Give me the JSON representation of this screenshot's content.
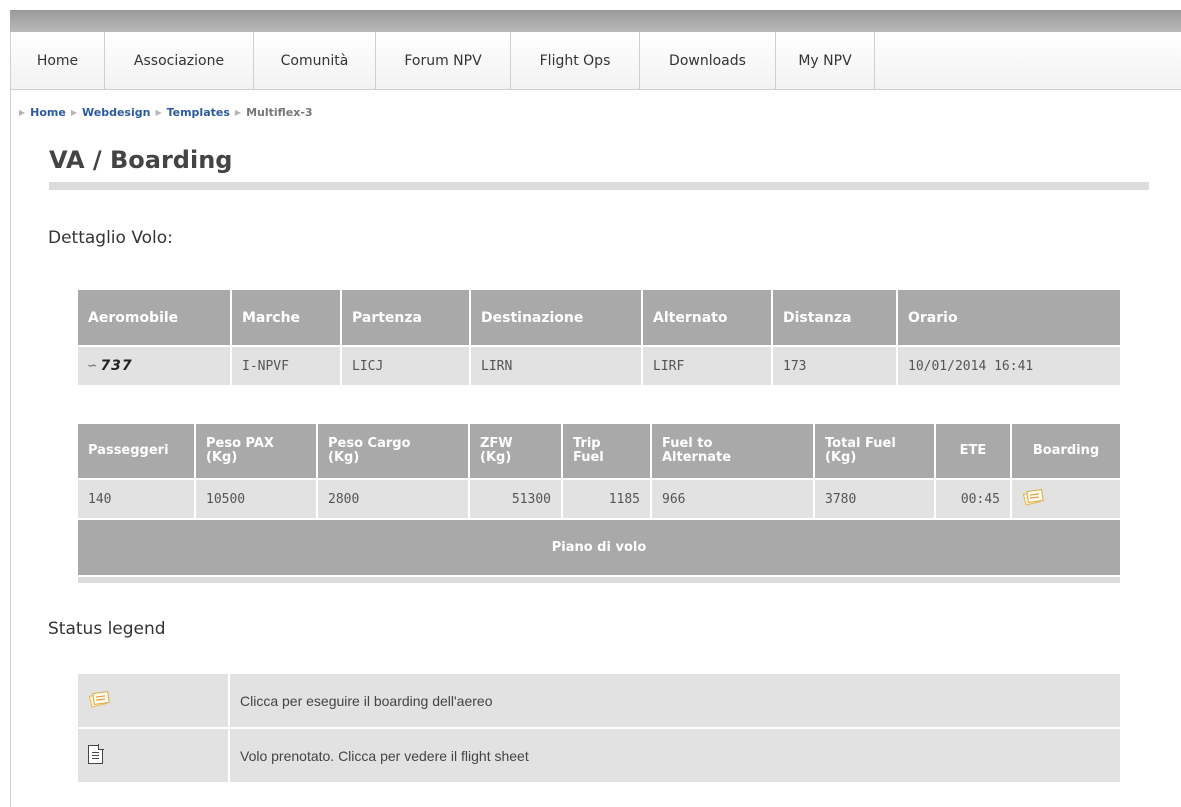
{
  "nav": {
    "items": [
      {
        "label": "Home",
        "width": 94
      },
      {
        "label": "Associazione",
        "width": 149
      },
      {
        "label": "Comunità",
        "width": 122
      },
      {
        "label": "Forum NPV",
        "width": 135
      },
      {
        "label": "Flight Ops",
        "width": 129
      },
      {
        "label": "Downloads",
        "width": 136
      },
      {
        "label": "My NPV",
        "width": 99
      }
    ]
  },
  "breadcrumb": {
    "items": [
      "Home",
      "Webdesign",
      "Templates"
    ],
    "current": "Multiflex-3"
  },
  "page": {
    "title": "VA / Boarding",
    "section_detail": "Dettaglio Volo:",
    "section_legend": "Status legend"
  },
  "flight": {
    "headers": [
      "Aeromobile",
      "Marche",
      "Partenza",
      "Destinazione",
      "Alternato",
      "Distanza",
      "Orario"
    ],
    "aircraft_model": "737",
    "aircraft_icon": "boeing-logo-icon",
    "registration": "I-NPVF",
    "departure": "LICJ",
    "destination": "LIRN",
    "alternate": "LIRF",
    "distance": "173",
    "time": "10/01/2014 16:41"
  },
  "load": {
    "headers": {
      "passengers": "Passeggeri",
      "pax_weight": "Peso PAX",
      "pax_weight_unit": "(Kg)",
      "cargo_weight": "Peso Cargo",
      "cargo_weight_unit": "(Kg)",
      "zfw": "ZFW",
      "zfw_unit": "(Kg)",
      "trip_fuel": "Trip",
      "trip_fuel_2": "Fuel",
      "fuel_alt": "Fuel to",
      "fuel_alt_2": "Alternate",
      "total_fuel": "Total Fuel",
      "total_fuel_unit": "(Kg)",
      "ete": "ETE",
      "boarding": "Boarding"
    },
    "values": {
      "passengers": "140",
      "pax_weight": "10500",
      "cargo_weight": "2800",
      "zfw": "51300",
      "trip_fuel": "1185",
      "fuel_alt": "966",
      "total_fuel": "3780",
      "ete": "00:45"
    },
    "boarding_icon": "boarding-pass-icon",
    "flight_plan_label": "Piano di volo"
  },
  "legend": {
    "rows": [
      {
        "icon": "boarding-pass-icon",
        "text": "Clicca per eseguire il boarding dell'aereo"
      },
      {
        "icon": "document-icon",
        "text": "Volo prenotato. Clicca per vedere il flight sheet"
      }
    ]
  },
  "colors": {
    "header_bg": "#a9a9a9",
    "cell_bg": "#e2e2e2",
    "link": "#2c5aa0"
  }
}
